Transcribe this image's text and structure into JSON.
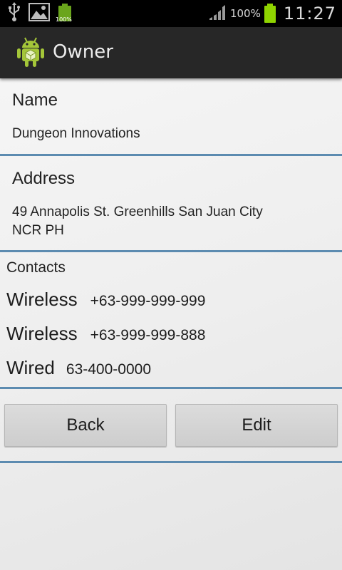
{
  "status_bar": {
    "left_icons": [
      "usb-icon",
      "image-icon",
      "battery-notification-icon"
    ],
    "small_battery_text": "100%",
    "signal_icon": "signal-bars-icon",
    "battery_percent": "100%",
    "time": "11:27",
    "battery_color": "#8fd400"
  },
  "action_bar": {
    "icon": "android-robot-icon",
    "title": "Owner"
  },
  "name_section": {
    "heading": "Name",
    "value": "Dungeon Innovations"
  },
  "address_section": {
    "heading": "Address",
    "line1": "49 Annapolis St. Greenhills San Juan City",
    "line2": "NCR PH"
  },
  "contacts_section": {
    "heading": "Contacts",
    "items": [
      {
        "type": "Wireless",
        "number": "+63-999-999-999"
      },
      {
        "type": "Wireless",
        "number": "+63-999-999-888"
      },
      {
        "type": "Wired",
        "number": "63-400-0000"
      }
    ]
  },
  "buttons": {
    "back_label": "Back",
    "edit_label": "Edit"
  },
  "colors": {
    "divider": "#5c8bb0",
    "action_bar": "#272727",
    "status_bar": "#000000"
  }
}
